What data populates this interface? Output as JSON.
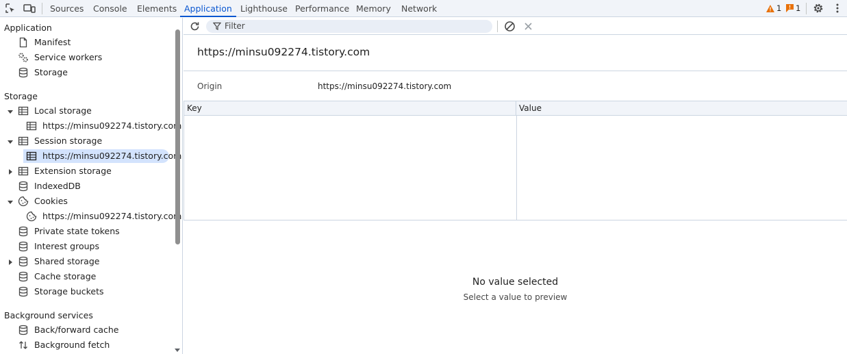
{
  "topbar": {
    "tabs": [
      "Sources",
      "Console",
      "Elements",
      "Application",
      "Lighthouse",
      "Performance",
      "Memory",
      "Network"
    ],
    "active_tab": "Application",
    "warnings_count": "1",
    "issues_count": "1",
    "accent": "#0b57d0"
  },
  "sidebar": {
    "application": {
      "heading": "Application",
      "items": [
        "Manifest",
        "Service workers",
        "Storage"
      ]
    },
    "storage": {
      "heading": "Storage",
      "local_storage": "Local storage",
      "local_storage_origin": "https://minsu092274.tistory.com",
      "session_storage": "Session storage",
      "session_storage_origin": "https://minsu092274.tistory.com",
      "extension_storage": "Extension storage",
      "indexeddb": "IndexedDB",
      "cookies": "Cookies",
      "cookies_origin": "https://minsu092274.tistory.com",
      "private_state_tokens": "Private state tokens",
      "interest_groups": "Interest groups",
      "shared_storage": "Shared storage",
      "cache_storage": "Cache storage",
      "storage_buckets": "Storage buckets"
    },
    "background": {
      "heading": "Background services",
      "items": [
        "Back/forward cache",
        "Background fetch"
      ]
    }
  },
  "main": {
    "filter_placeholder": "Filter",
    "origin_title": "https://minsu092274.tistory.com",
    "origin_label": "Origin",
    "origin_value": "https://minsu092274.tistory.com",
    "columns": [
      "Key",
      "Value"
    ],
    "empty_title": "No value selected",
    "empty_sub": "Select a value to preview"
  }
}
